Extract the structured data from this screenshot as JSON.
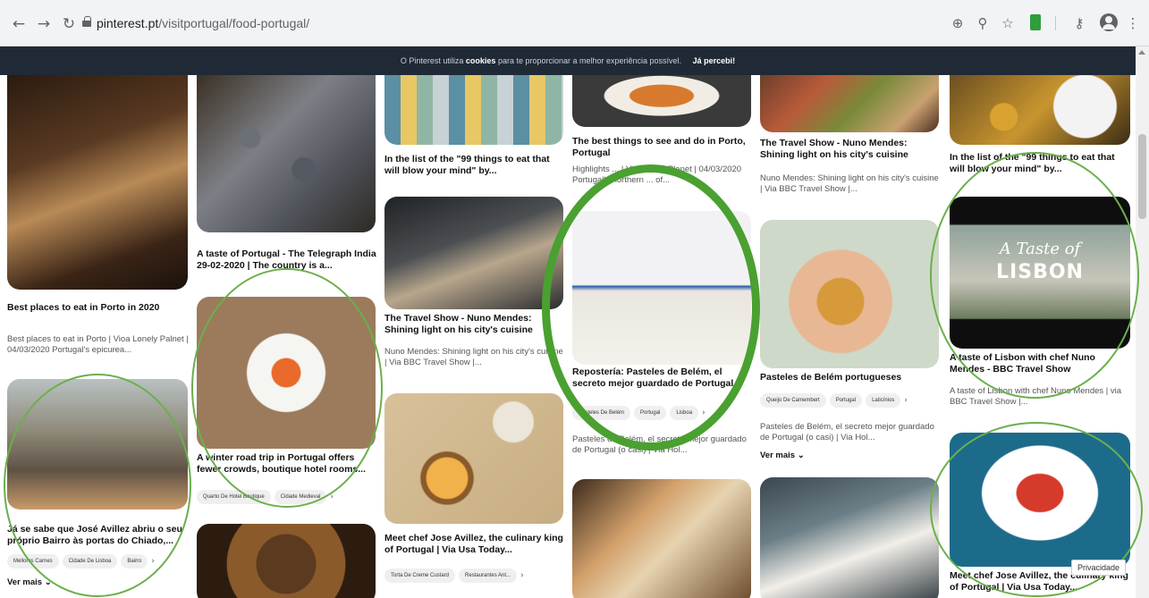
{
  "browser": {
    "url_host": "pinterest.pt",
    "url_path": "/visitportugal/food-portugal/",
    "back_icon": "back-arrow-icon",
    "forward_icon": "forward-arrow-icon",
    "reload_icon": "reload-icon"
  },
  "cookie_banner": {
    "text_before": "O Pinterest utiliza",
    "bold": "cookies",
    "text_after": "para te proporcionar a melhor experiência possível.",
    "accept": "Já percebi!"
  },
  "pins": {
    "c1": {
      "title1": "Best places to eat in Porto in 2020",
      "desc1": "Best places to eat in Porto | Vioa Lonely Palnet | 04/03/2020 Portugal's epicurea...",
      "title2": "Já se sabe que José Avillez abriu o seu próprio Bairro às portas do Chiado,...",
      "tags2": [
        "Mellores Carnes",
        "Cidade De Lisboa",
        "Bairro"
      ],
      "more": "Ver mais"
    },
    "c2": {
      "title1": "A taste of Portugal - The Telegraph India 29-02-2020 | The country is a...",
      "title2": "A winter road trip in Portugal offers fewer crowds, boutique hotel rooms...",
      "tags2": [
        "Quarto De Hotel Boutique",
        "Cidade Medieval"
      ]
    },
    "c3": {
      "title1": "In the list of the \"99 things to eat that will blow your mind\" by...",
      "title2": "The Travel Show - Nuno Mendes: Shining light on his city's cuisine",
      "desc2": "Nuno Mendes: Shining light on his city's cuisine | Via BBC Travel Show |...",
      "title3": "Meet chef Jose Avillez, the culinary king of Portugal | Via Usa Today...",
      "tags3": [
        "Torta De Creme Custard",
        "Restaurantes Ant..."
      ]
    },
    "c4": {
      "title1": "The best things to see and do in Porto, Portugal",
      "desc1": "Highlights ... | Via Lonely Planet | 04/03/2020 Portugal's northern ... of...",
      "title2": "Repostería: Pasteles de Belém, el secreto mejor guardado de Portugal...",
      "tags2": [
        "Pasteles De Belém",
        "Portugal",
        "Lisboa"
      ],
      "desc2": "Pasteles de Belém, el secreto mejor guardado de Portugal (o casi) | Via Hol..."
    },
    "c5": {
      "title1": "The Travel Show - Nuno Mendes: Shining light on his city's cuisine",
      "desc1": "Nuno Mendes: Shining light on his city's cuisine | Via BBC Travel Show |...",
      "title2": "Pasteles de Belém portugueses",
      "tags2": [
        "Queijo De Camembert",
        "Portugal",
        "Laticínios"
      ],
      "desc2": "Pasteles de Belém, el secreto mejor guardado de Portugal (o casi) | Via Hol...",
      "more": "Ver mais"
    },
    "c6": {
      "title1": "In the list of the \"99 things to eat that will blow your mind\" by...",
      "lisbon_title": "A Taste of",
      "lisbon_sub": "LISBON",
      "title2": "A taste of Lisbon with chef Nuno Mendes - BBC Travel Show",
      "desc2": "A taste of Lisbon with chef Nuno Mendes | via BBC Travel Show |...",
      "title3": "Meet chef Jose Avillez, the culinary king of Portugal | Via Usa Today..."
    }
  },
  "privacy": "Privacidade",
  "colors": {
    "ring": "#6ab04c",
    "banner": "#1f2a36"
  }
}
